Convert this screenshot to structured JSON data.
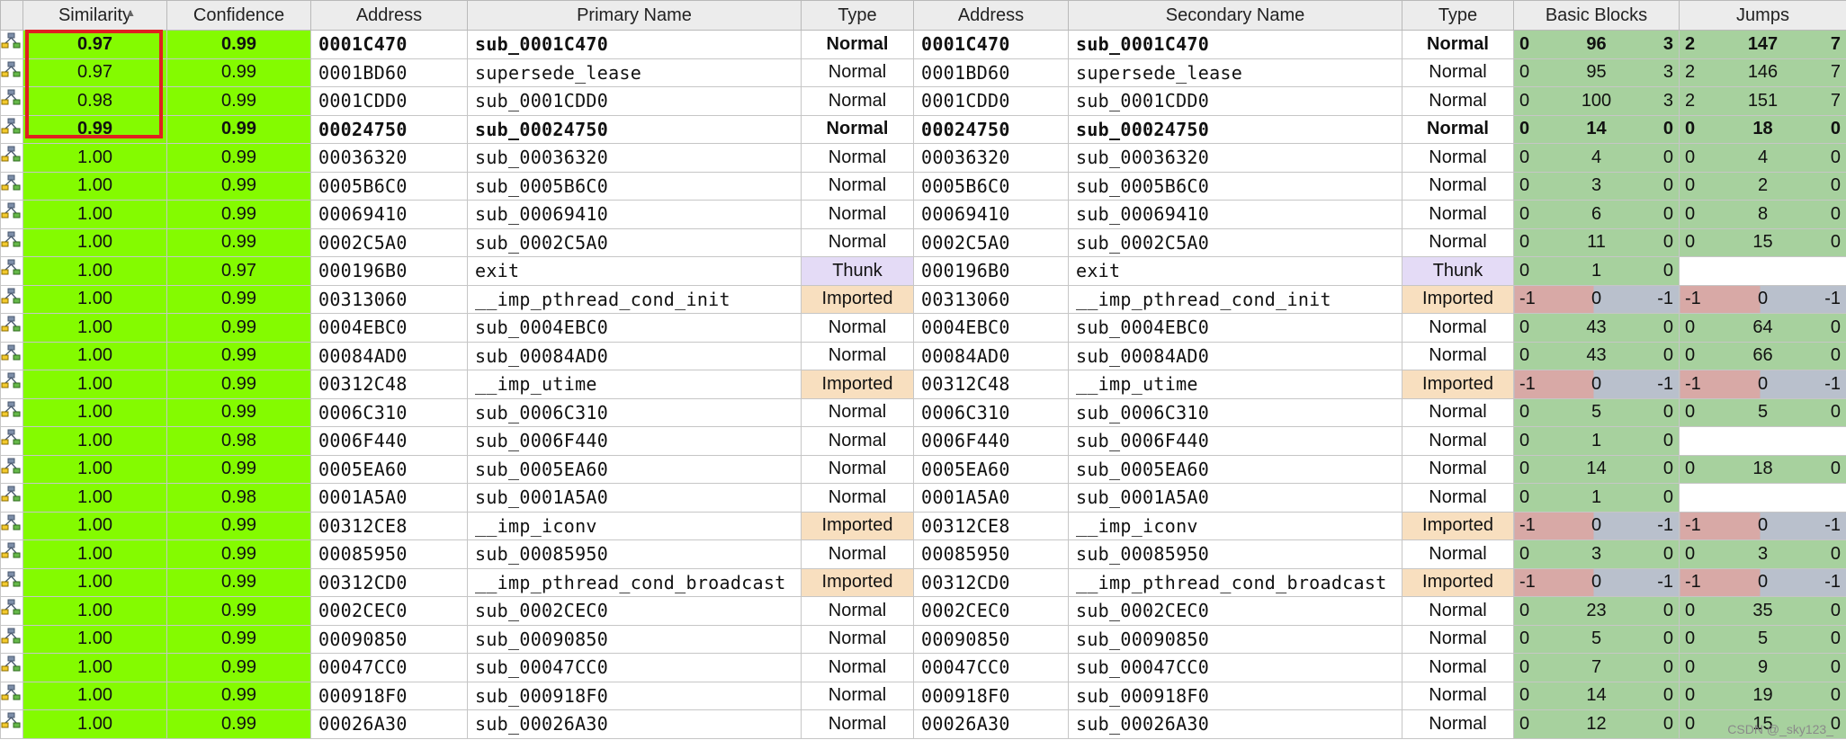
{
  "headers": [
    "",
    "Similarity",
    "Confidence",
    "Address",
    "Primary Name",
    "Type",
    "Address",
    "Secondary Name",
    "Type",
    "Basic Blocks",
    "Jumps"
  ],
  "sort_indicator": "▲",
  "rows": [
    {
      "bold": true,
      "similarity": "0.97",
      "confidence": "0.99",
      "addr1": "0001C470",
      "name1": "sub_0001C470",
      "type1": "Normal",
      "addr2": "0001C470",
      "name2": "sub_0001C470",
      "type2": "Normal",
      "bb": [
        "0",
        "96",
        "3"
      ],
      "bb_style": "green",
      "jumps": [
        "2",
        "147",
        "7"
      ],
      "jumps_style": "green"
    },
    {
      "bold": false,
      "similarity": "0.97",
      "confidence": "0.99",
      "addr1": "0001BD60",
      "name1": "supersede_lease",
      "type1": "Normal",
      "addr2": "0001BD60",
      "name2": "supersede_lease",
      "type2": "Normal",
      "bb": [
        "0",
        "95",
        "3"
      ],
      "bb_style": "green",
      "jumps": [
        "2",
        "146",
        "7"
      ],
      "jumps_style": "green"
    },
    {
      "bold": false,
      "similarity": "0.98",
      "confidence": "0.99",
      "addr1": "0001CDD0",
      "name1": "sub_0001CDD0",
      "type1": "Normal",
      "addr2": "0001CDD0",
      "name2": "sub_0001CDD0",
      "type2": "Normal",
      "bb": [
        "0",
        "100",
        "3"
      ],
      "bb_style": "green",
      "jumps": [
        "2",
        "151",
        "7"
      ],
      "jumps_style": "green"
    },
    {
      "bold": true,
      "similarity": "0.99",
      "confidence": "0.99",
      "addr1": "00024750",
      "name1": "sub_00024750",
      "type1": "Normal",
      "addr2": "00024750",
      "name2": "sub_00024750",
      "type2": "Normal",
      "bb": [
        "0",
        "14",
        "0"
      ],
      "bb_style": "green",
      "jumps": [
        "0",
        "18",
        "0"
      ],
      "jumps_style": "green"
    },
    {
      "bold": false,
      "similarity": "1.00",
      "confidence": "0.99",
      "addr1": "00036320",
      "name1": "sub_00036320",
      "type1": "Normal",
      "addr2": "00036320",
      "name2": "sub_00036320",
      "type2": "Normal",
      "bb": [
        "0",
        "4",
        "0"
      ],
      "bb_style": "green",
      "jumps": [
        "0",
        "4",
        "0"
      ],
      "jumps_style": "green"
    },
    {
      "bold": false,
      "similarity": "1.00",
      "confidence": "0.99",
      "addr1": "0005B6C0",
      "name1": "sub_0005B6C0",
      "type1": "Normal",
      "addr2": "0005B6C0",
      "name2": "sub_0005B6C0",
      "type2": "Normal",
      "bb": [
        "0",
        "3",
        "0"
      ],
      "bb_style": "green",
      "jumps": [
        "0",
        "2",
        "0"
      ],
      "jumps_style": "green"
    },
    {
      "bold": false,
      "similarity": "1.00",
      "confidence": "0.99",
      "addr1": "00069410",
      "name1": "sub_00069410",
      "type1": "Normal",
      "addr2": "00069410",
      "name2": "sub_00069410",
      "type2": "Normal",
      "bb": [
        "0",
        "6",
        "0"
      ],
      "bb_style": "green",
      "jumps": [
        "0",
        "8",
        "0"
      ],
      "jumps_style": "green"
    },
    {
      "bold": false,
      "similarity": "1.00",
      "confidence": "0.99",
      "addr1": "0002C5A0",
      "name1": "sub_0002C5A0",
      "type1": "Normal",
      "addr2": "0002C5A0",
      "name2": "sub_0002C5A0",
      "type2": "Normal",
      "bb": [
        "0",
        "11",
        "0"
      ],
      "bb_style": "green",
      "jumps": [
        "0",
        "15",
        "0"
      ],
      "jumps_style": "green"
    },
    {
      "bold": false,
      "similarity": "1.00",
      "confidence": "0.97",
      "addr1": "000196B0",
      "name1": "exit",
      "type1": "Thunk",
      "addr2": "000196B0",
      "name2": "exit",
      "type2": "Thunk",
      "bb": [
        "0",
        "1",
        "0"
      ],
      "bb_style": "green",
      "jumps": [],
      "jumps_style": "empty"
    },
    {
      "bold": false,
      "similarity": "1.00",
      "confidence": "0.99",
      "addr1": "00313060",
      "name1": "__imp_pthread_cond_init",
      "type1": "Imported",
      "addr2": "00313060",
      "name2": "__imp_pthread_cond_init",
      "type2": "Imported",
      "bb": [
        "-1",
        "0",
        "-1"
      ],
      "bb_style": "mixed",
      "jumps": [
        "-1",
        "0",
        "-1"
      ],
      "jumps_style": "mixed"
    },
    {
      "bold": false,
      "similarity": "1.00",
      "confidence": "0.99",
      "addr1": "0004EBC0",
      "name1": "sub_0004EBC0",
      "type1": "Normal",
      "addr2": "0004EBC0",
      "name2": "sub_0004EBC0",
      "type2": "Normal",
      "bb": [
        "0",
        "43",
        "0"
      ],
      "bb_style": "green",
      "jumps": [
        "0",
        "64",
        "0"
      ],
      "jumps_style": "green"
    },
    {
      "bold": false,
      "similarity": "1.00",
      "confidence": "0.99",
      "addr1": "00084AD0",
      "name1": "sub_00084AD0",
      "type1": "Normal",
      "addr2": "00084AD0",
      "name2": "sub_00084AD0",
      "type2": "Normal",
      "bb": [
        "0",
        "43",
        "0"
      ],
      "bb_style": "green",
      "jumps": [
        "0",
        "66",
        "0"
      ],
      "jumps_style": "green"
    },
    {
      "bold": false,
      "similarity": "1.00",
      "confidence": "0.99",
      "addr1": "00312C48",
      "name1": "__imp_utime",
      "type1": "Imported",
      "addr2": "00312C48",
      "name2": "__imp_utime",
      "type2": "Imported",
      "bb": [
        "-1",
        "0",
        "-1"
      ],
      "bb_style": "mixed",
      "jumps": [
        "-1",
        "0",
        "-1"
      ],
      "jumps_style": "mixed"
    },
    {
      "bold": false,
      "similarity": "1.00",
      "confidence": "0.99",
      "addr1": "0006C310",
      "name1": "sub_0006C310",
      "type1": "Normal",
      "addr2": "0006C310",
      "name2": "sub_0006C310",
      "type2": "Normal",
      "bb": [
        "0",
        "5",
        "0"
      ],
      "bb_style": "green",
      "jumps": [
        "0",
        "5",
        "0"
      ],
      "jumps_style": "green"
    },
    {
      "bold": false,
      "similarity": "1.00",
      "confidence": "0.98",
      "addr1": "0006F440",
      "name1": "sub_0006F440",
      "type1": "Normal",
      "addr2": "0006F440",
      "name2": "sub_0006F440",
      "type2": "Normal",
      "bb": [
        "0",
        "1",
        "0"
      ],
      "bb_style": "green",
      "jumps": [],
      "jumps_style": "empty"
    },
    {
      "bold": false,
      "similarity": "1.00",
      "confidence": "0.99",
      "addr1": "0005EA60",
      "name1": "sub_0005EA60",
      "type1": "Normal",
      "addr2": "0005EA60",
      "name2": "sub_0005EA60",
      "type2": "Normal",
      "bb": [
        "0",
        "14",
        "0"
      ],
      "bb_style": "green",
      "jumps": [
        "0",
        "18",
        "0"
      ],
      "jumps_style": "green"
    },
    {
      "bold": false,
      "similarity": "1.00",
      "confidence": "0.98",
      "addr1": "0001A5A0",
      "name1": "sub_0001A5A0",
      "type1": "Normal",
      "addr2": "0001A5A0",
      "name2": "sub_0001A5A0",
      "type2": "Normal",
      "bb": [
        "0",
        "1",
        "0"
      ],
      "bb_style": "green",
      "jumps": [],
      "jumps_style": "empty"
    },
    {
      "bold": false,
      "similarity": "1.00",
      "confidence": "0.99",
      "addr1": "00312CE8",
      "name1": "__imp_iconv",
      "type1": "Imported",
      "addr2": "00312CE8",
      "name2": "__imp_iconv",
      "type2": "Imported",
      "bb": [
        "-1",
        "0",
        "-1"
      ],
      "bb_style": "mixed",
      "jumps": [
        "-1",
        "0",
        "-1"
      ],
      "jumps_style": "mixed"
    },
    {
      "bold": false,
      "similarity": "1.00",
      "confidence": "0.99",
      "addr1": "00085950",
      "name1": "sub_00085950",
      "type1": "Normal",
      "addr2": "00085950",
      "name2": "sub_00085950",
      "type2": "Normal",
      "bb": [
        "0",
        "3",
        "0"
      ],
      "bb_style": "green",
      "jumps": [
        "0",
        "3",
        "0"
      ],
      "jumps_style": "green"
    },
    {
      "bold": false,
      "similarity": "1.00",
      "confidence": "0.99",
      "addr1": "00312CD0",
      "name1": "__imp_pthread_cond_broadcast",
      "type1": "Imported",
      "addr2": "00312CD0",
      "name2": "__imp_pthread_cond_broadcast",
      "type2": "Imported",
      "bb": [
        "-1",
        "0",
        "-1"
      ],
      "bb_style": "mixed",
      "jumps": [
        "-1",
        "0",
        "-1"
      ],
      "jumps_style": "mixed"
    },
    {
      "bold": false,
      "similarity": "1.00",
      "confidence": "0.99",
      "addr1": "0002CEC0",
      "name1": "sub_0002CEC0",
      "type1": "Normal",
      "addr2": "0002CEC0",
      "name2": "sub_0002CEC0",
      "type2": "Normal",
      "bb": [
        "0",
        "23",
        "0"
      ],
      "bb_style": "green",
      "jumps": [
        "0",
        "35",
        "0"
      ],
      "jumps_style": "green"
    },
    {
      "bold": false,
      "similarity": "1.00",
      "confidence": "0.99",
      "addr1": "00090850",
      "name1": "sub_00090850",
      "type1": "Normal",
      "addr2": "00090850",
      "name2": "sub_00090850",
      "type2": "Normal",
      "bb": [
        "0",
        "5",
        "0"
      ],
      "bb_style": "green",
      "jumps": [
        "0",
        "5",
        "0"
      ],
      "jumps_style": "green"
    },
    {
      "bold": false,
      "similarity": "1.00",
      "confidence": "0.99",
      "addr1": "00047CC0",
      "name1": "sub_00047CC0",
      "type1": "Normal",
      "addr2": "00047CC0",
      "name2": "sub_00047CC0",
      "type2": "Normal",
      "bb": [
        "0",
        "7",
        "0"
      ],
      "bb_style": "green",
      "jumps": [
        "0",
        "9",
        "0"
      ],
      "jumps_style": "green"
    },
    {
      "bold": false,
      "similarity": "1.00",
      "confidence": "0.99",
      "addr1": "000918F0",
      "name1": "sub_000918F0",
      "type1": "Normal",
      "addr2": "000918F0",
      "name2": "sub_000918F0",
      "type2": "Normal",
      "bb": [
        "0",
        "14",
        "0"
      ],
      "bb_style": "green",
      "jumps": [
        "0",
        "19",
        "0"
      ],
      "jumps_style": "green"
    },
    {
      "bold": false,
      "similarity": "1.00",
      "confidence": "0.99",
      "addr1": "00026A30",
      "name1": "sub_00026A30",
      "type1": "Normal",
      "addr2": "00026A30",
      "name2": "sub_00026A30",
      "type2": "Normal",
      "bb": [
        "0",
        "12",
        "0"
      ],
      "bb_style": "green",
      "jumps": [
        "0",
        "15",
        "0"
      ],
      "jumps_style": "green"
    }
  ],
  "watermark": "CSDN @_sky123_",
  "colors": {
    "similarity_fill": "#84fb00",
    "highlight_box": "#e02020",
    "imported": "#f8dfbf",
    "thunk": "#e4dbf6",
    "match_green": "#a7d19e"
  },
  "row_icon": "flow-graph-icon"
}
